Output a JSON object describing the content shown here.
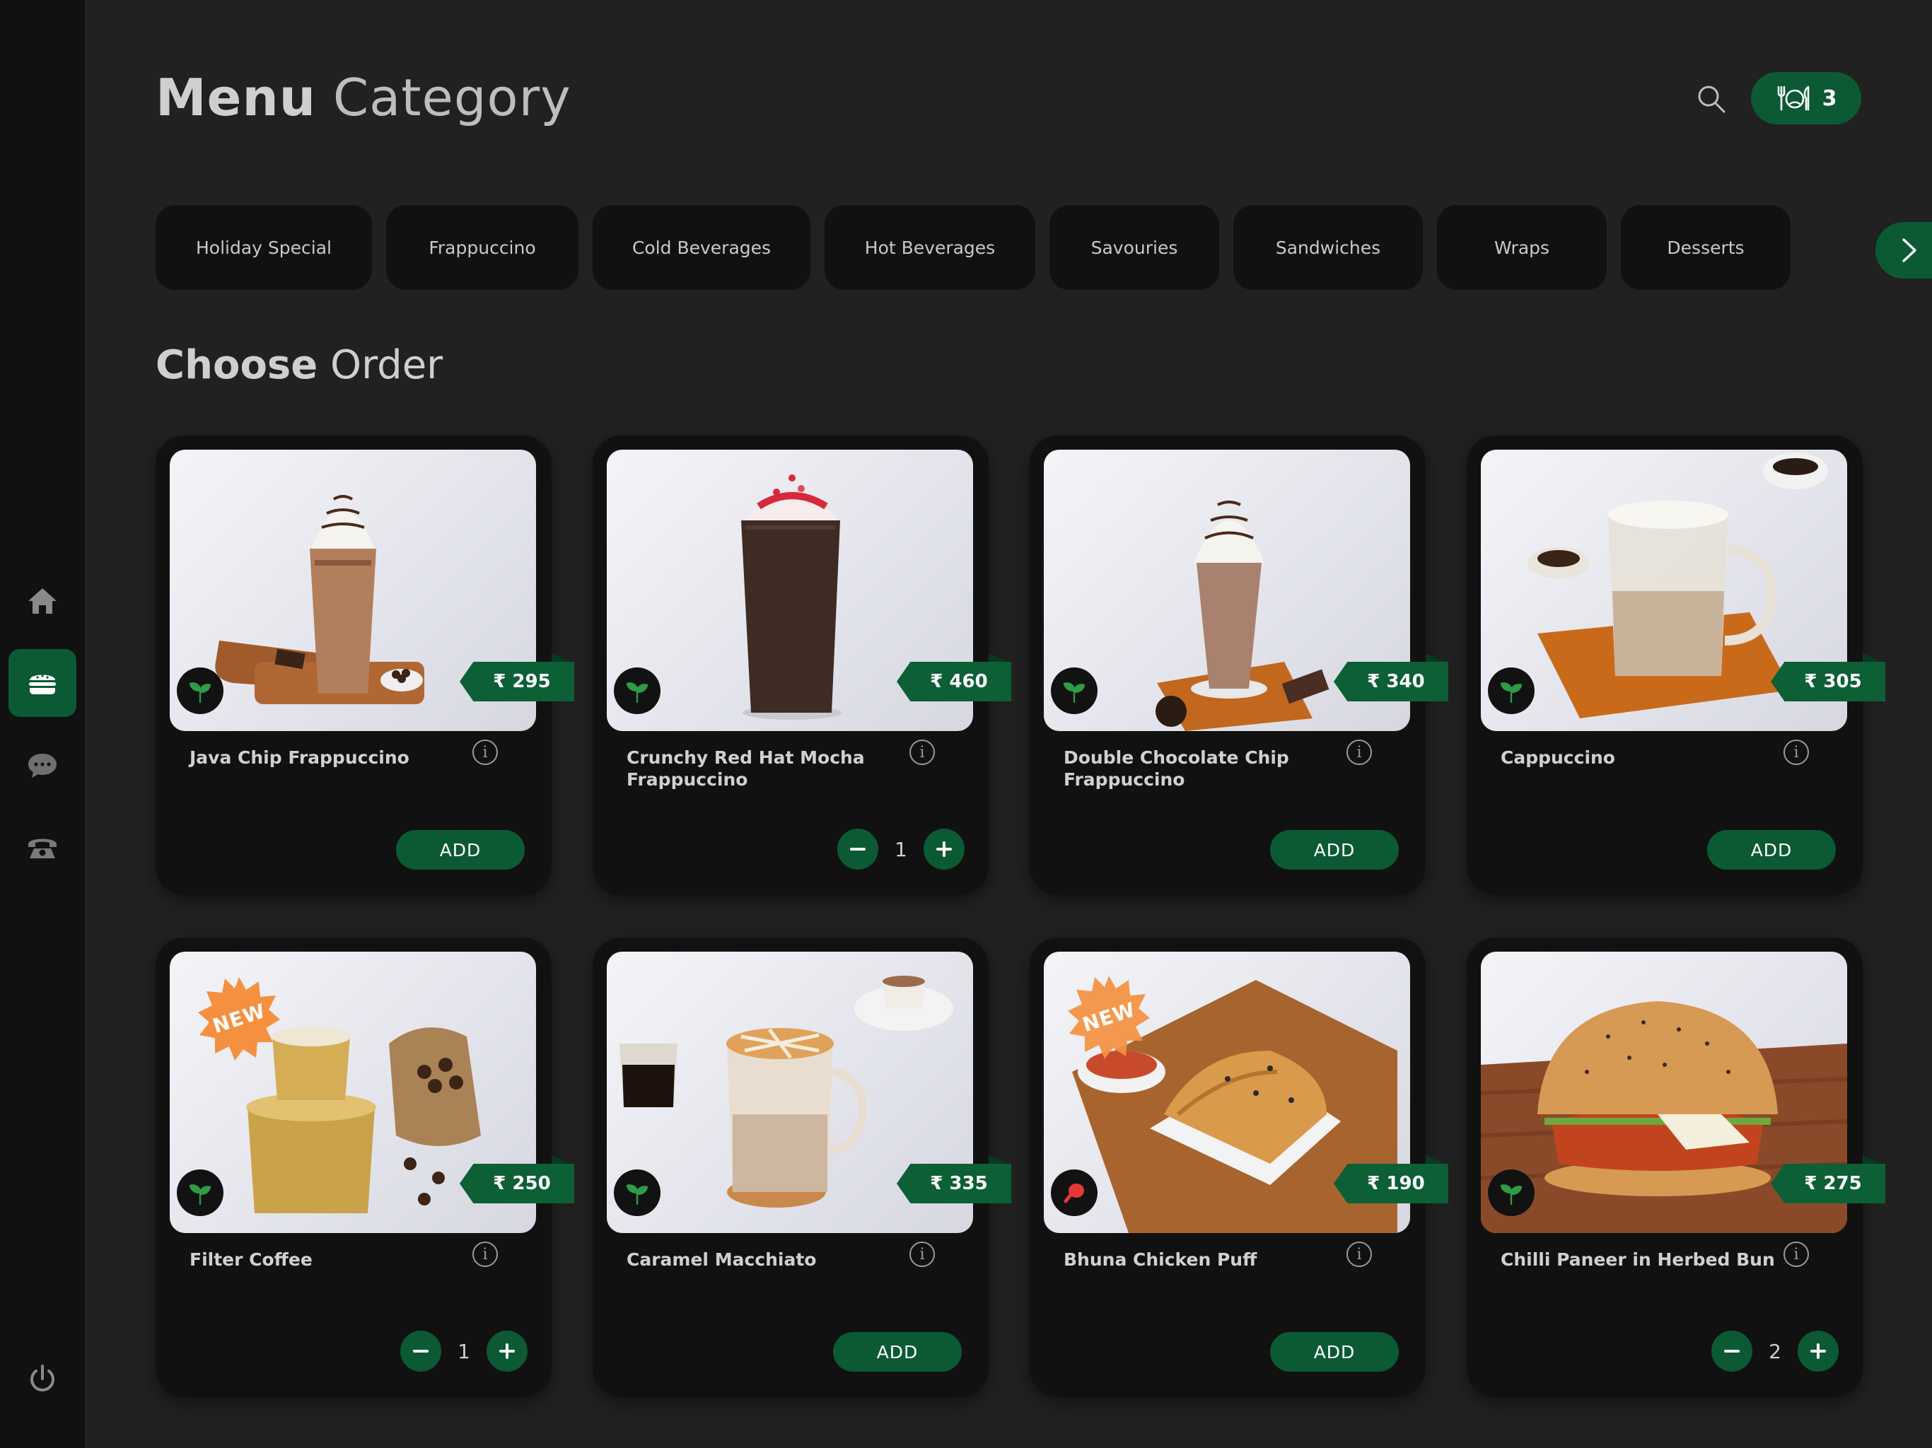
{
  "header": {
    "title_bold": "Menu",
    "title_light": "Category",
    "cart_count": "3"
  },
  "tabs": [
    "Holiday Special",
    "Frappuccino",
    "Cold Beverages",
    "Hot Beverages",
    "Savouries",
    "Sandwiches",
    "Wraps",
    "Desserts"
  ],
  "section": {
    "title_bold": "Choose",
    "title_light": "Order"
  },
  "sidebar": {
    "items": [
      "home-icon",
      "burger-icon",
      "chat-icon",
      "phone-icon",
      "power-icon"
    ],
    "active": "burger-icon"
  },
  "labels": {
    "add": "ADD",
    "info": "i",
    "new": "NEW"
  },
  "colors": {
    "accent": "#0b5a33",
    "background": "#212121",
    "card": "#111111",
    "veg": "#2e9b47",
    "nonveg": "#e53935"
  },
  "items": [
    {
      "name": "Java Chip Frappuccino",
      "price": "₹ 295",
      "diet": "veg",
      "state": "add",
      "qty": "",
      "is_new": false
    },
    {
      "name": "Crunchy Red Hat Mocha Frappuccino",
      "price": "₹ 460",
      "diet": "veg",
      "state": "qty",
      "qty": "1",
      "is_new": false
    },
    {
      "name": "Double Chocolate Chip Frappuccino",
      "price": "₹ 340",
      "diet": "veg",
      "state": "add",
      "qty": "",
      "is_new": false
    },
    {
      "name": "Cappuccino",
      "price": "₹ 305",
      "diet": "veg",
      "state": "add",
      "qty": "",
      "is_new": false
    },
    {
      "name": "Filter Coffee",
      "price": "₹ 250",
      "diet": "veg",
      "state": "qty",
      "qty": "1",
      "is_new": true
    },
    {
      "name": "Caramel Macchiato",
      "price": "₹ 335",
      "diet": "veg",
      "state": "add",
      "qty": "",
      "is_new": false
    },
    {
      "name": "Bhuna Chicken Puff",
      "price": "₹ 190",
      "diet": "nonveg",
      "state": "add",
      "qty": "",
      "is_new": true
    },
    {
      "name": "Chilli Paneer in Herbed Bun",
      "price": "₹ 275",
      "diet": "veg",
      "state": "qty",
      "qty": "2",
      "is_new": false
    }
  ]
}
